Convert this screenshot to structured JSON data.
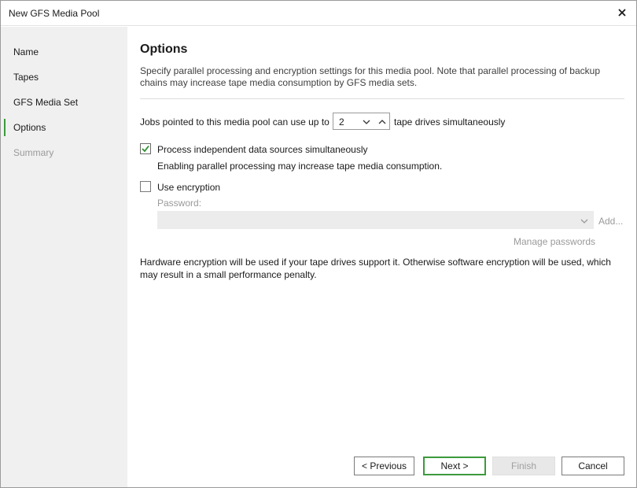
{
  "window": {
    "title": "New GFS Media Pool",
    "close_icon": "close-icon"
  },
  "sidebar": {
    "items": [
      {
        "label": "Name",
        "state": "normal"
      },
      {
        "label": "Tapes",
        "state": "normal"
      },
      {
        "label": "GFS Media Set",
        "state": "normal"
      },
      {
        "label": "Options",
        "state": "active"
      },
      {
        "label": "Summary",
        "state": "disabled"
      }
    ]
  },
  "main": {
    "heading": "Options",
    "description": "Specify parallel processing and encryption settings for this media pool. Note that parallel processing of backup chains may increase tape media consumption by GFS media sets.",
    "drives": {
      "prefix": "Jobs pointed to this media pool can use up to",
      "value": "2",
      "suffix": "tape drives simultaneously"
    },
    "parallel": {
      "checked": true,
      "label": "Process independent data sources simultaneously",
      "note": "Enabling parallel processing may increase tape media consumption."
    },
    "encryption": {
      "checked": false,
      "label": "Use encryption",
      "password_label": "Password:",
      "password_value": "",
      "add_label": "Add...",
      "manage_label": "Manage passwords"
    },
    "hardware_note": "Hardware encryption will be used if your tape drives support it. Otherwise software encryption will be used, which may result in a small performance penalty."
  },
  "footer": {
    "previous_label": "< Previous",
    "next_label": "Next >",
    "finish_label": "Finish",
    "cancel_label": "Cancel"
  },
  "colors": {
    "accent": "#3c9a3c",
    "sidebar_bg": "#f0f0f0",
    "disabled_text": "#9a9a9a"
  }
}
